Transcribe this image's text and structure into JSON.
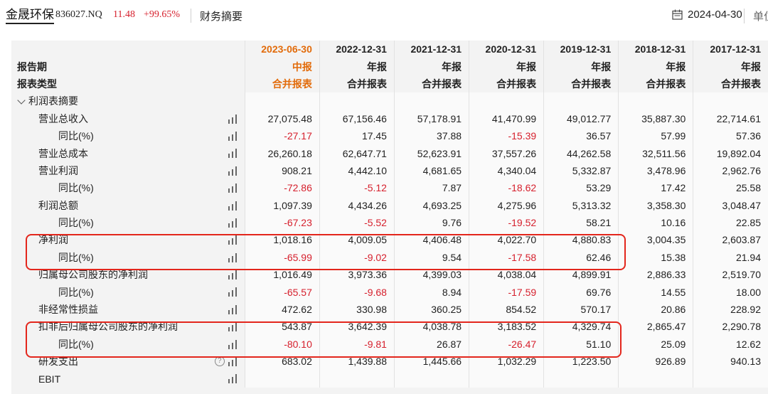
{
  "topbar": {
    "stock_name": "金晟环保",
    "stock_code": "836027.NQ",
    "price": "11.48",
    "change": "+99.65%",
    "section_title": "财务摘要",
    "date": "2024-04-30",
    "unit_label": "单位"
  },
  "table": {
    "header_rows": [
      {
        "label": "",
        "cells": [
          "2023-06-30",
          "2022-12-31",
          "2021-12-31",
          "2020-12-31",
          "2019-12-31",
          "2018-12-31",
          "2017-12-31"
        ]
      },
      {
        "label": "报告期",
        "cells": [
          "中报",
          "年报",
          "年报",
          "年报",
          "年报",
          "年报",
          "年报"
        ]
      },
      {
        "label": "报表类型",
        "cells": [
          "合并报表",
          "合并报表",
          "合并报表",
          "合并报表",
          "合并报表",
          "合并报表",
          "合并报表"
        ]
      }
    ],
    "section_title": "利润表摘要",
    "rows": [
      {
        "label": "营业总收入",
        "level": 1,
        "values": [
          "27,075.48",
          "67,156.46",
          "57,178.91",
          "41,470.99",
          "49,012.77",
          "35,887.30",
          "22,714.61"
        ]
      },
      {
        "label": "同比(%)",
        "level": 2,
        "values": [
          "-27.17",
          "17.45",
          "37.88",
          "-15.39",
          "36.57",
          "57.99",
          "57.36"
        ]
      },
      {
        "label": "营业总成本",
        "level": 1,
        "values": [
          "26,260.18",
          "62,647.71",
          "52,623.91",
          "37,557.26",
          "44,262.58",
          "32,511.56",
          "19,892.04"
        ]
      },
      {
        "label": "营业利润",
        "level": 1,
        "values": [
          "908.21",
          "4,442.10",
          "4,681.65",
          "4,340.04",
          "5,332.87",
          "3,478.96",
          "2,962.76"
        ]
      },
      {
        "label": "同比(%)",
        "level": 2,
        "values": [
          "-72.86",
          "-5.12",
          "7.87",
          "-18.62",
          "53.29",
          "17.42",
          "25.58"
        ]
      },
      {
        "label": "利润总额",
        "level": 1,
        "values": [
          "1,097.39",
          "4,434.26",
          "4,693.25",
          "4,275.96",
          "5,313.32",
          "3,358.30",
          "3,048.47"
        ]
      },
      {
        "label": "同比(%)",
        "level": 2,
        "values": [
          "-67.23",
          "-5.52",
          "9.76",
          "-19.52",
          "58.21",
          "10.16",
          "22.85"
        ]
      },
      {
        "label": "净利润",
        "level": 1,
        "values": [
          "1,018.16",
          "4,009.05",
          "4,406.48",
          "4,022.70",
          "4,880.83",
          "3,004.35",
          "2,603.87"
        ]
      },
      {
        "label": "同比(%)",
        "level": 2,
        "values": [
          "-65.99",
          "-9.02",
          "9.54",
          "-17.58",
          "62.46",
          "15.38",
          "21.94"
        ]
      },
      {
        "label": "归属母公司股东的净利润",
        "level": 1,
        "values": [
          "1,016.49",
          "3,973.36",
          "4,399.03",
          "4,038.04",
          "4,899.91",
          "2,886.33",
          "2,519.70"
        ]
      },
      {
        "label": "同比(%)",
        "level": 2,
        "values": [
          "-65.57",
          "-9.68",
          "8.94",
          "-17.59",
          "69.76",
          "14.55",
          "18.00"
        ]
      },
      {
        "label": "非经常性损益",
        "level": 1,
        "values": [
          "472.62",
          "330.98",
          "360.25",
          "854.52",
          "570.17",
          "20.86",
          "228.92"
        ]
      },
      {
        "label": "扣非后归属母公司股东的净利润",
        "level": 1,
        "values": [
          "543.87",
          "3,642.39",
          "4,038.78",
          "3,183.52",
          "4,329.74",
          "2,865.47",
          "2,290.78"
        ]
      },
      {
        "label": "同比(%)",
        "level": 2,
        "values": [
          "-80.10",
          "-9.81",
          "26.87",
          "-26.47",
          "51.10",
          "25.09",
          "12.62"
        ]
      },
      {
        "label": "研发支出",
        "level": 1,
        "help": true,
        "values": [
          "683.02",
          "1,439.88",
          "1,445.66",
          "1,032.29",
          "1,223.50",
          "926.89",
          "940.13"
        ]
      },
      {
        "label": "EBIT",
        "level": 1,
        "values": [
          "",
          "",
          "",
          "",
          "",
          "",
          ""
        ]
      }
    ]
  },
  "colors": {
    "accent_orange": "#e26b0a",
    "negative_red": "#d6202d",
    "highlight_box": "#e3261c"
  },
  "icons": [
    "calendar-icon",
    "chevron-down-icon",
    "bar-chart-icon",
    "help-icon"
  ]
}
